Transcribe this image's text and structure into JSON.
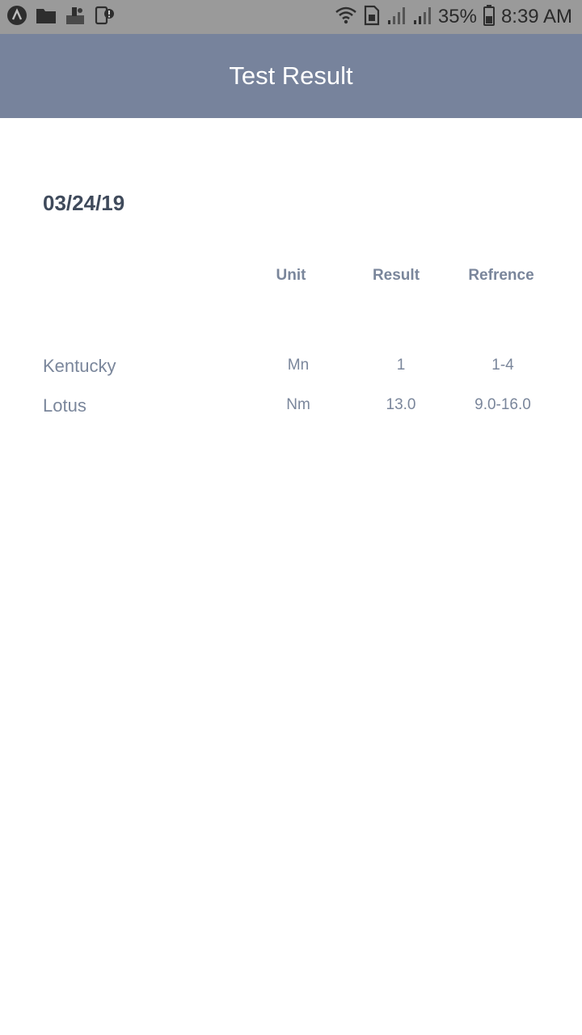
{
  "status_bar": {
    "icons_left": [
      "app-launcher-icon",
      "folder-icon",
      "cleaner-icon",
      "device-alert-icon"
    ],
    "icons_right": [
      "wifi-icon",
      "sim-card-icon",
      "signal-icon",
      "signal-icon",
      "battery-icon"
    ],
    "battery_percent": "35%",
    "time": "8:39 AM"
  },
  "header": {
    "title": "Test Result"
  },
  "report": {
    "date": "03/24/19",
    "columns": {
      "unit": "Unit",
      "result": "Result",
      "reference": "Refrence"
    },
    "rows": [
      {
        "name": "Kentucky",
        "unit": "Mn",
        "result": "1",
        "reference": "1-4"
      },
      {
        "name": "Lotus",
        "unit": "Nm",
        "result": "13.0",
        "reference": "9.0-16.0"
      }
    ]
  }
}
